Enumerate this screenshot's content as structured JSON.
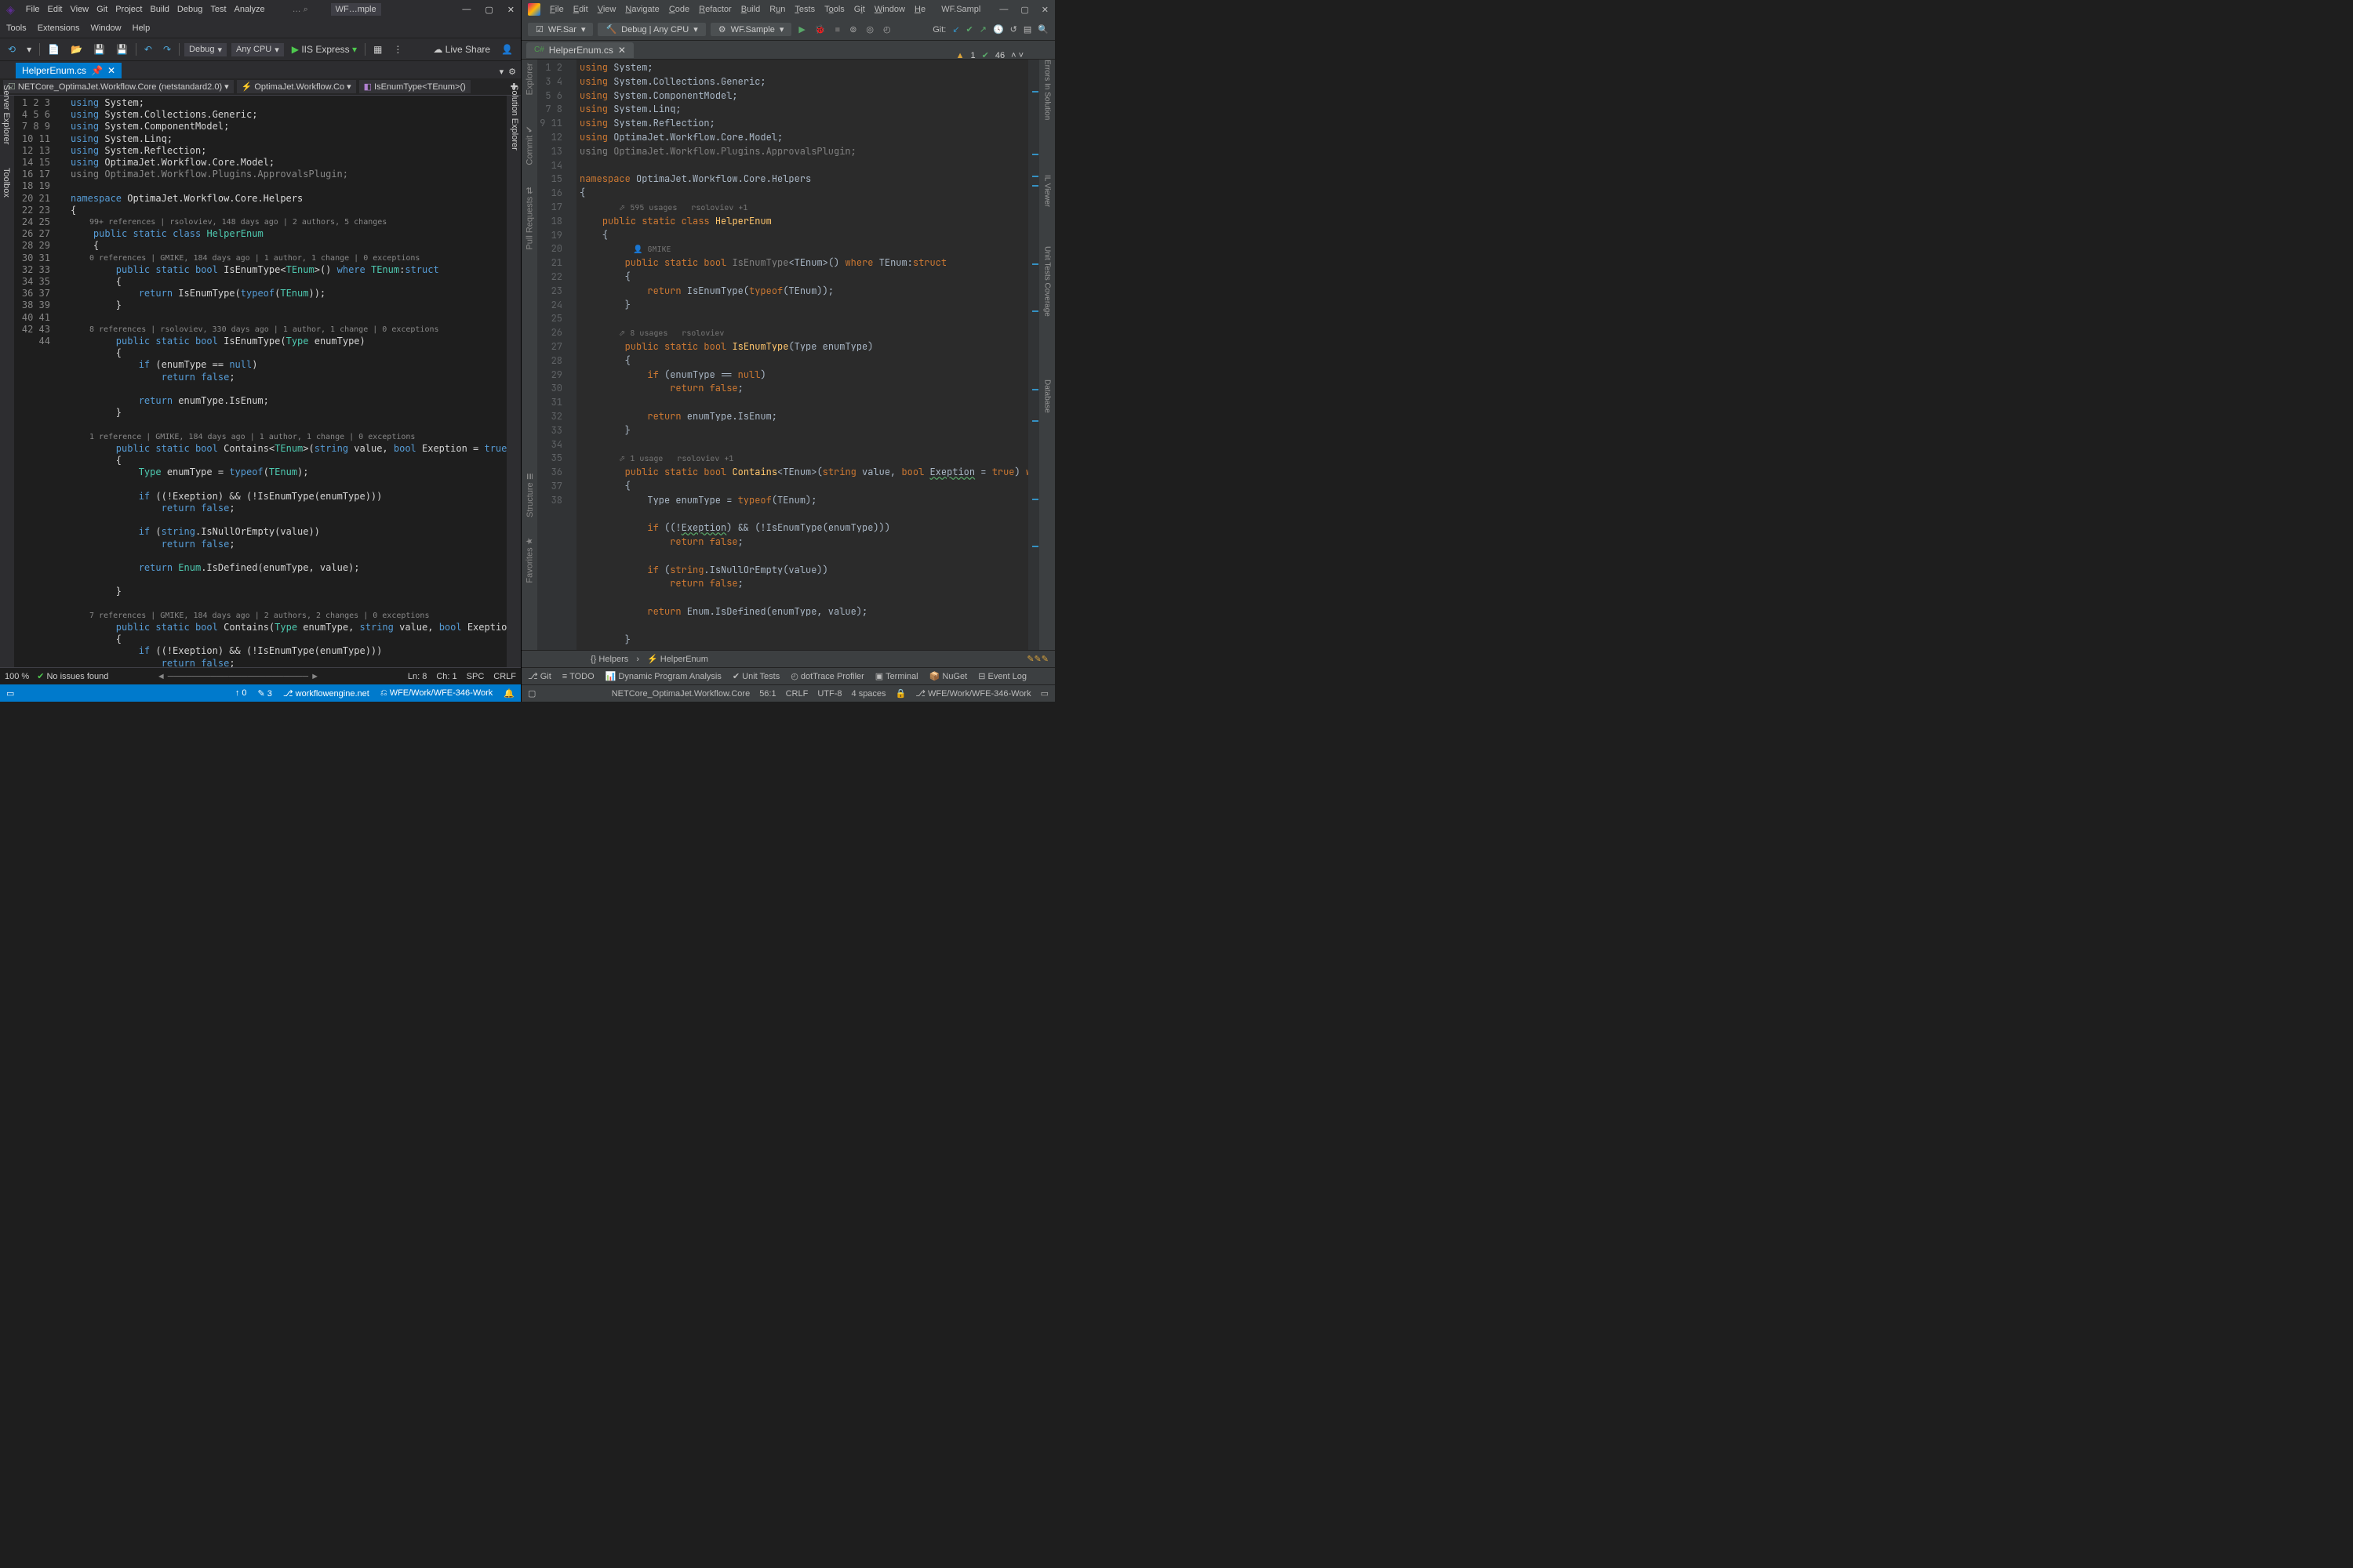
{
  "vs": {
    "menu": [
      "File",
      "Edit",
      "View",
      "Git",
      "Project",
      "Build",
      "Debug",
      "Test",
      "Analyze"
    ],
    "menu2": [
      "Tools",
      "Extensions",
      "Window",
      "Help"
    ],
    "search_icon": "…",
    "search_hotkey": "⌕",
    "titlebar_tab": "WF…mple",
    "toolbar": {
      "config": "Debug",
      "platform": "Any CPU",
      "run_label": "IIS Express",
      "liveshare": "Live Share"
    },
    "tab": {
      "name": "HelperEnum.cs"
    },
    "ctx": {
      "project": "NETCore_OptimaJet.Workflow.Core (netstandard2.0)",
      "class": "OptimaJet.Workflow.Co",
      "member": "IsEnumType<TEnum>()"
    },
    "vert_left": [
      "Server Explorer",
      "Toolbox"
    ],
    "vert_right": [
      "Solution Explorer"
    ],
    "codelens": {
      "l10": "99+ references | rsoloviev, 148 days ago | 2 authors, 5 changes",
      "l12": "0 references | GMIKE, 184 days ago | 1 author, 1 change | 0 exceptions",
      "l17": "8 references | rsoloviev, 330 days ago | 1 author, 1 change | 0 exceptions",
      "l25": "1 reference | GMIKE, 184 days ago | 1 author, 1 change | 0 exceptions",
      "l39": "7 references | GMIKE, 184 days ago | 2 authors, 2 changes | 0 exceptions"
    },
    "status": {
      "zoom": "100 %",
      "issues": "No issues found",
      "ln": "Ln: 8",
      "ch": "Ch: 1",
      "ins": "SPC",
      "eol": "CRLF",
      "ready": "",
      "up": "0",
      "edits": "3",
      "repo": "workflowengine.net",
      "branch": "WFE/Work/WFE-346-Work"
    }
  },
  "rider": {
    "menu": [
      "File",
      "Edit",
      "View",
      "Navigate",
      "Code",
      "Refactor",
      "Build",
      "Run",
      "Tests",
      "Tools",
      "Git",
      "Window",
      "He"
    ],
    "wintitle": "WF.Sampl",
    "toolbar": {
      "sln": "WF.Sar",
      "config": "Debug | Any CPU",
      "run": "WF.Sample",
      "git_label": "Git:"
    },
    "tab": {
      "prefix": "C#",
      "name": "HelperEnum.cs"
    },
    "lines": {
      "ns": "OptimaJet.Workflow.Core.Helpers",
      "cls": "HelperEnum"
    },
    "annot": {
      "l10": "595 usages   rsoloviev +1",
      "l12b": "GMIKE",
      "l17b": "8 usages   rsoloviev",
      "l25b": "1 usage   rsoloviev +1"
    },
    "errs": {
      "warn": "1",
      "hint": "46"
    },
    "vert_left": [
      "Explorer",
      "Commit",
      "Pull Requests",
      "Structure",
      "Favorites"
    ],
    "vert_right": [
      "Errors In Solution",
      "IL Viewer",
      "Unit Tests Coverage",
      "Database"
    ],
    "bread": {
      "a": "Helpers",
      "b": "HelperEnum"
    },
    "toolstrip": [
      "Git",
      "TODO",
      "Dynamic Program Analysis",
      "Unit Tests",
      "dotTrace Profiler",
      "Terminal",
      "NuGet",
      "Event Log"
    ],
    "status": {
      "proj": "NETCore_OptimaJet.Workflow.Core",
      "pos": "56:1",
      "eol": "CRLF",
      "enc": "UTF-8",
      "indent": "4 spaces",
      "branch": "WFE/Work/WFE-346-Work"
    }
  }
}
